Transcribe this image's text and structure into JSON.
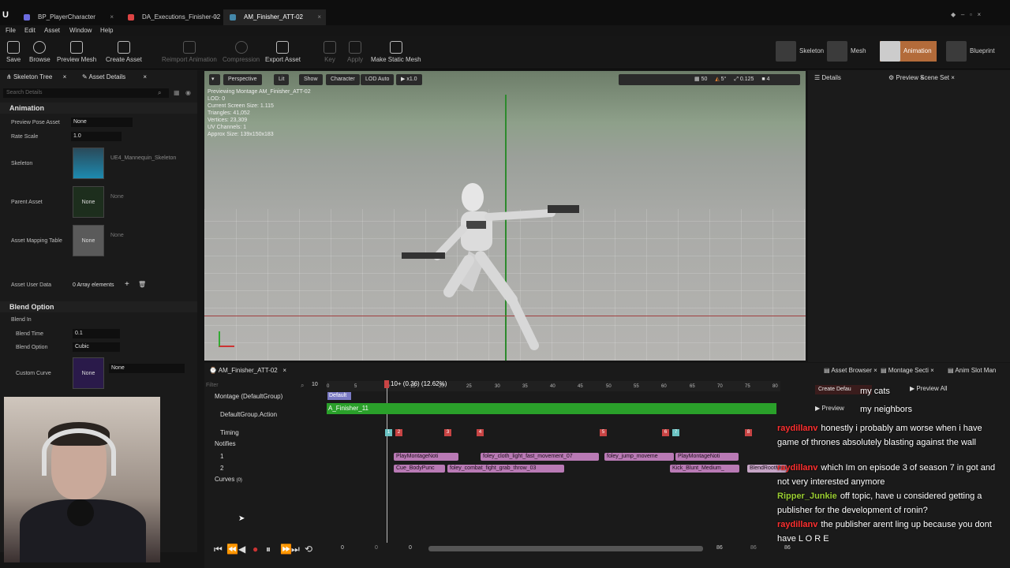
{
  "tabs": [
    {
      "label": "BP_PlayerCharacter"
    },
    {
      "label": "DA_Executions_Finisher-02"
    },
    {
      "label": "AM_Finisher_ATT-02"
    }
  ],
  "menu": [
    "File",
    "Edit",
    "Asset",
    "Window",
    "Help"
  ],
  "toolbar": {
    "save": "Save",
    "browse": "Browse",
    "preview_mesh": "Preview Mesh",
    "create_asset": "Create Asset",
    "reimport": "Reimport Animation",
    "compression": "Compression",
    "export": "Export Asset",
    "key": "Key",
    "apply": "Apply",
    "make_static": "Make Static Mesh"
  },
  "modes": {
    "skeleton": "Skeleton",
    "mesh": "Mesh",
    "animation": "Animation",
    "blueprint": "Blueprint"
  },
  "left": {
    "tab1": "Skeleton Tree",
    "tab2": "Asset Details",
    "search_placeholder": "Search Details",
    "section_animation": "Animation",
    "preview_pose_label": "Preview Pose Asset",
    "preview_pose_value": "None",
    "rate_scale_label": "Rate Scale",
    "rate_scale_value": "1.0",
    "skeleton_label": "Skeleton",
    "skeleton_value": "UE4_Mannequin_Skeleton",
    "parent_label": "Parent Asset",
    "parent_thumb": "None",
    "parent_value": "None",
    "mapping_label": "Asset Mapping Table",
    "mapping_thumb": "None",
    "mapping_value": "None",
    "user_data_label": "Asset User Data",
    "user_data_value": "0 Array elements",
    "section_blend": "Blend Option",
    "blend_in": "Blend In",
    "blend_time_label": "Blend Time",
    "blend_time_value": "0.1",
    "blend_option_label": "Blend Option",
    "blend_option_value": "Cubic",
    "custom_curve_label": "Custom Curve",
    "custom_curve_thumb": "None",
    "custom_curve_value": "None"
  },
  "viewport": {
    "perspective": "Perspective",
    "lit": "Lit",
    "show": "Show",
    "character": "Character",
    "lod": "LOD Auto",
    "speed": "x1.0",
    "grid": "50",
    "angle": "5°",
    "scale": "0.125",
    "cam": "4",
    "info": [
      "Previewing Montage AM_Finisher_ATT-02",
      "LOD: 0",
      "Current Screen Size: 1.115",
      "Triangles: 41,052",
      "Vertices: 23,309",
      "UV Channels: 1",
      "Approx Size: 139x150x183"
    ]
  },
  "right": {
    "details": "Details",
    "preview_scene": "Preview Scene Set"
  },
  "montage": {
    "tab": "AM_Finisher_ATT-02",
    "filter_placeholder": "Filter",
    "frame_field": "10",
    "playhead": "10+ (0.36) (12.62%)",
    "ruler": [
      "0",
      "5",
      "10",
      "15",
      "20",
      "25",
      "30",
      "35",
      "40",
      "45",
      "50",
      "55",
      "60",
      "65",
      "70",
      "75",
      "80"
    ],
    "tracks": {
      "montage": "Montage (DefaultGroup)",
      "action": "DefaultGroup.Action",
      "timing": "Timing",
      "notifies": "Notifies",
      "n1": "1",
      "n2": "2",
      "curves": "Curves",
      "curves_count": "(0)"
    },
    "section_default": "Default",
    "slot_bar": "A_Finisher_11",
    "timing_markers": [
      "1",
      "2",
      "3",
      "4",
      "5",
      "6",
      "7",
      "8"
    ],
    "notifies_row1": [
      "PlayMontageNoti",
      "foley_cloth_light_fast_movement_07",
      "foley_jump_moveme",
      "PlayMontageNoti"
    ],
    "notifies_row2": [
      "Cue_BodyPunc",
      "foley_combat_fight_grab_throw_03",
      "Kick_Blunt_Medium_",
      "BlendRootMotion"
    ],
    "playback_values": [
      "0",
      "0",
      "0",
      "86",
      "86",
      "86"
    ]
  },
  "right_bottom": {
    "asset_browser": "Asset Browser",
    "montage_sections": "Montage Secti",
    "anim_slot": "Anim Slot Man",
    "create_default": "Create Defau",
    "preview_all": "Preview All",
    "preview": "Preview"
  },
  "chat": [
    {
      "user": "",
      "msg": "my cats",
      "color": "#ffffff"
    },
    {
      "user": "",
      "msg": "my neighbors",
      "color": "#ffffff"
    },
    {
      "user": "raydillanv",
      "msg": "honestly i probably am worse when i have game of thrones absolutely blasting against the wall",
      "color": "#ff3030"
    },
    {
      "user": "raydillanv",
      "msg": "which Im on episode 3 of season 7 in got and not very interested anymore",
      "color": "#ff3030"
    },
    {
      "user": "Ripper_Junkie",
      "msg": "off topic, have u considered getting a publisher for the development of ronin?",
      "color": "#9acd32"
    },
    {
      "user": "raydillanv",
      "msg": "the publisher arent ling up because you dont have L O R E",
      "color": "#ff3030"
    }
  ]
}
